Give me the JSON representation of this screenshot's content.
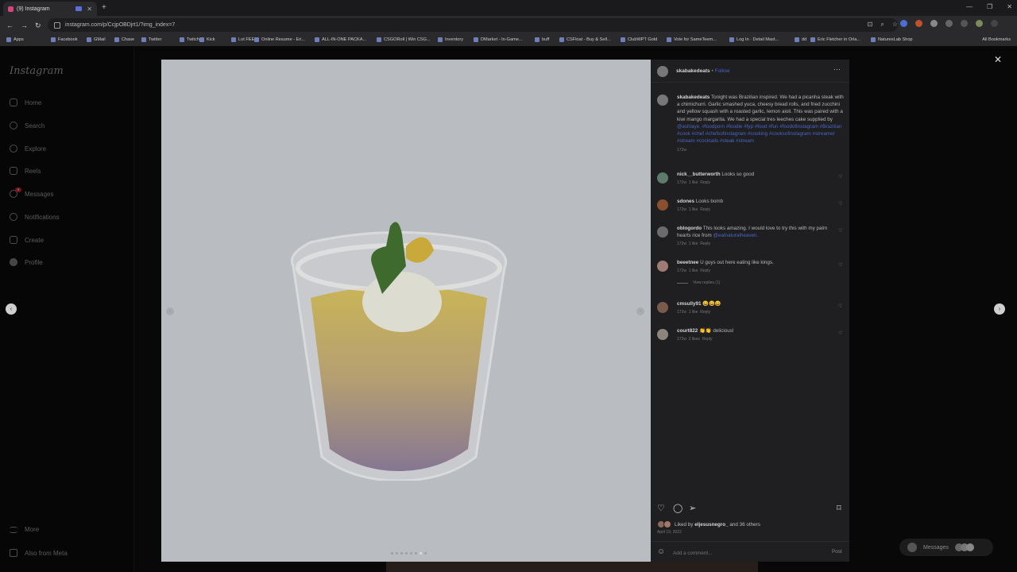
{
  "browser": {
    "tab_title": "(9) Instagram",
    "url": "instagram.com/p/CcjpOBDjrt1/?img_index=7",
    "bookmarks": [
      "Apps",
      "Facebook",
      "GMail",
      "Chase",
      "Twitter",
      "Twitch",
      "Kick",
      "Lot FEE",
      "Online Resume - Eri...",
      "ALL-IN-ONE PACKA...",
      "CSGORoll | Win CSG...",
      "Inventory",
      "DMarket - In-Game...",
      "buff",
      "CSFloat - Buy & Sell...",
      "ClubWPT Gold",
      "Vote for SameTeem...",
      "Log In · Detail Mast...",
      "dd",
      "Eric Fletcher in Orla...",
      "NaturesLab Shop"
    ],
    "all_bookmarks": "All Bookmarks"
  },
  "sidebar": {
    "logo": "Instagram",
    "items": [
      {
        "label": "Home"
      },
      {
        "label": "Search"
      },
      {
        "label": "Explore"
      },
      {
        "label": "Reels"
      },
      {
        "label": "Messages",
        "badge": "9"
      },
      {
        "label": "Notifications"
      },
      {
        "label": "Create"
      },
      {
        "label": "Profile"
      }
    ],
    "more": "More",
    "also_from_meta": "Also from Meta"
  },
  "post": {
    "author": "skabakedeats",
    "follow": "Follow",
    "caption_user": "skabakedeats",
    "caption": "Tonight was Brazilian inspired. We had a picanha steak with a chimichurri. Garlic smashed yuca, cheesy bread rolls, and fried zucchini and yellow squash with a roasted garlic, lemon aioli. This was paired with a kiwi mango margarita. We had a special tres leeches cake supplied by",
    "caption_mention": "@ashlaye.",
    "caption_tags": "#foodporn #foodie #fyp #food #fun #foodofinstagram #Brazilian #cook #chef #chefsofinstagram #cooking #cooksofinstagram #streamer #stream #cocktails #steak #stream",
    "caption_age": "172w",
    "comments": [
      {
        "user": "nick__butterworth",
        "text": "Looks so good",
        "age": "172w",
        "likes": "1 like",
        "reply": "Reply"
      },
      {
        "user": "sdones",
        "text": "Looks bomb",
        "age": "172w",
        "likes": "1 like",
        "reply": "Reply"
      },
      {
        "user": "oblogordo",
        "text": "This looks amazing. I would love to try this with my palm hearts rice from",
        "mention": "@eatnaturalheaven.",
        "age": "172w",
        "likes": "1 like",
        "reply": "Reply"
      },
      {
        "user": "beeetnee",
        "text": "U guys out here eating like kings.",
        "age": "172w",
        "likes": "1 like",
        "reply": "Reply",
        "view_replies": "View replies (1)"
      },
      {
        "user": "cmsully91",
        "text": "😀😀😀",
        "age": "172w",
        "likes": "1 like",
        "reply": "Reply"
      },
      {
        "user": "court822",
        "text": "👏👏 delicious!",
        "age": "172w",
        "likes": "2 likes",
        "reply": "Reply"
      }
    ],
    "liked_prefix": "Liked by",
    "liked_user": "eljesusnegro_",
    "liked_suffix": "and 36 others",
    "date": "April 19, 2022",
    "add_comment_placeholder": "Add a comment...",
    "post_label": "Post"
  },
  "floating_messages": "Messages",
  "icons": {
    "close": "close-icon",
    "more": "more-options-icon",
    "like": "heart-icon",
    "comment": "comment-icon",
    "share": "share-icon",
    "save": "bookmark-icon",
    "emoji": "emoji-icon"
  }
}
